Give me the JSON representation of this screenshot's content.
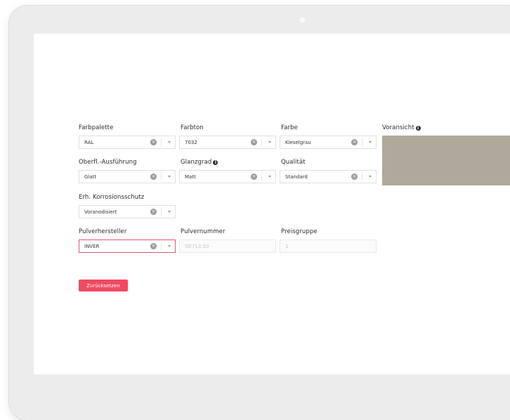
{
  "form": {
    "farbpalette": {
      "label": "Farbpalette",
      "value": "RAL"
    },
    "farbton": {
      "label": "Farbton",
      "value": "7032"
    },
    "farbe": {
      "label": "Farbe",
      "value": "Kieselgrau"
    },
    "voransicht": {
      "label": "Voransicht",
      "color": "#afa99b"
    },
    "oberflaeche": {
      "label": "Oberfl.-Ausführung",
      "value": "Glatt"
    },
    "glanzgrad": {
      "label": "Glanzgrad",
      "value": "Matt"
    },
    "qualitaet": {
      "label": "Qualität",
      "value": "Standard"
    },
    "korrosionsschutz": {
      "label": "Erh. Korrosionsschutz",
      "value": "Voranodisiert"
    },
    "pulverhersteller": {
      "label": "Pulverhersteller",
      "value": "INVER"
    },
    "pulvernummer": {
      "label": "Pulvernummer",
      "value": "SD713.50"
    },
    "preisgruppe": {
      "label": "Preisgruppe",
      "value": "1"
    },
    "reset_label": "Zurücksetzen"
  },
  "icons": {
    "clear": "clear-circle-icon",
    "caret": "chevron-down-icon",
    "info": "info-icon"
  },
  "colors": {
    "accent": "#f04a62",
    "active_border": "#e0556c"
  }
}
